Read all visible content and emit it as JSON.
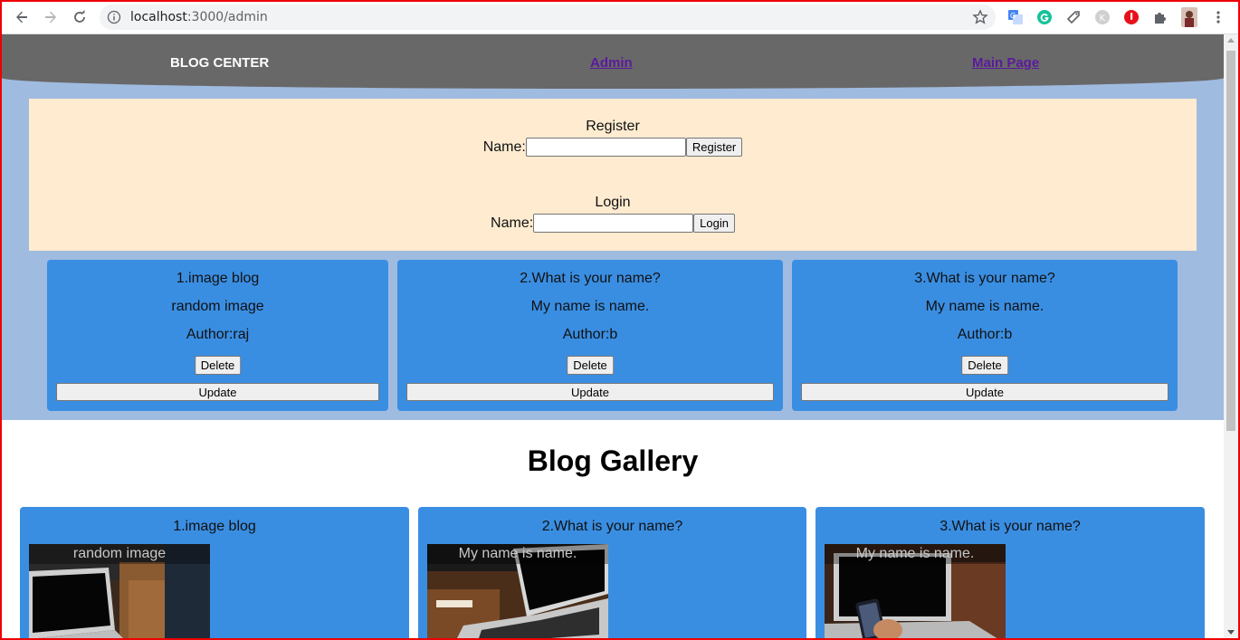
{
  "browser": {
    "url_host": "localhost",
    "url_path": ":3000/admin"
  },
  "header": {
    "brand": "BLOG CENTER",
    "links": [
      "Admin",
      "Main Page"
    ]
  },
  "register": {
    "title": "Register",
    "label": "Name:",
    "input_value": "",
    "button": "Register"
  },
  "login": {
    "title": "Login",
    "label": "Name:",
    "input_value": "",
    "button": "Login"
  },
  "admin_posts": [
    {
      "title": "1.image blog",
      "content": "random image",
      "author": "Author:raj",
      "delete_label": "Delete",
      "update_label": "Update"
    },
    {
      "title": "2.What is your name?",
      "content": "My name is name.",
      "author": "Author:b",
      "delete_label": "Delete",
      "update_label": "Update"
    },
    {
      "title": "3.What is your name?",
      "content": "My name is name.",
      "author": "Author:b",
      "delete_label": "Delete",
      "update_label": "Update"
    }
  ],
  "gallery": {
    "title": "Blog Gallery",
    "items": [
      {
        "title": "1.image blog",
        "caption": "random image"
      },
      {
        "title": "2.What is your name?",
        "caption": "My name is name."
      },
      {
        "title": "3.What is your name?",
        "caption": "My name is name."
      }
    ]
  }
}
